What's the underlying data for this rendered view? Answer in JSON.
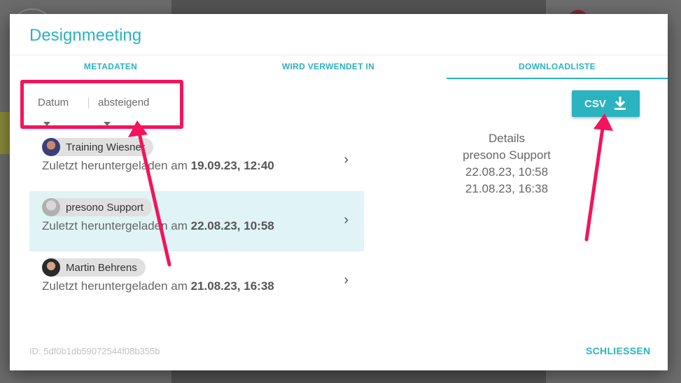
{
  "dialog": {
    "title": "Designmeeting",
    "tabs": [
      {
        "label": "METADATEN"
      },
      {
        "label": "WIRD VERWENDET IN"
      },
      {
        "label": "DOWNLOADLISTE",
        "active": true
      }
    ],
    "sort": {
      "field": "Datum",
      "order": "absteigend"
    },
    "csv_button": {
      "label": "CSV",
      "icon": "download-icon"
    },
    "downloads": [
      {
        "user": "Training Wiesner",
        "prefix": "Zuletzt heruntergeladen am ",
        "date": "19.09.23, 12:40"
      },
      {
        "user": "presono Support",
        "prefix": "Zuletzt heruntergeladen am ",
        "date": "22.08.23, 10:58",
        "selected": true
      },
      {
        "user": "Martin Behrens",
        "prefix": "Zuletzt heruntergeladen am ",
        "date": "21.08.23, 16:38"
      }
    ],
    "details": {
      "heading": "Details",
      "name": "presono Support",
      "dates": [
        "22.08.23, 10:58",
        "21.08.23, 16:38"
      ]
    },
    "id_text": "ID: 5df0b1db59072544f08b355b",
    "close_label": "SCHLIESSEN"
  },
  "colors": {
    "accent": "#2bb3c0",
    "annotation": "#f5135c",
    "selected_row": "#e0f3f5"
  }
}
